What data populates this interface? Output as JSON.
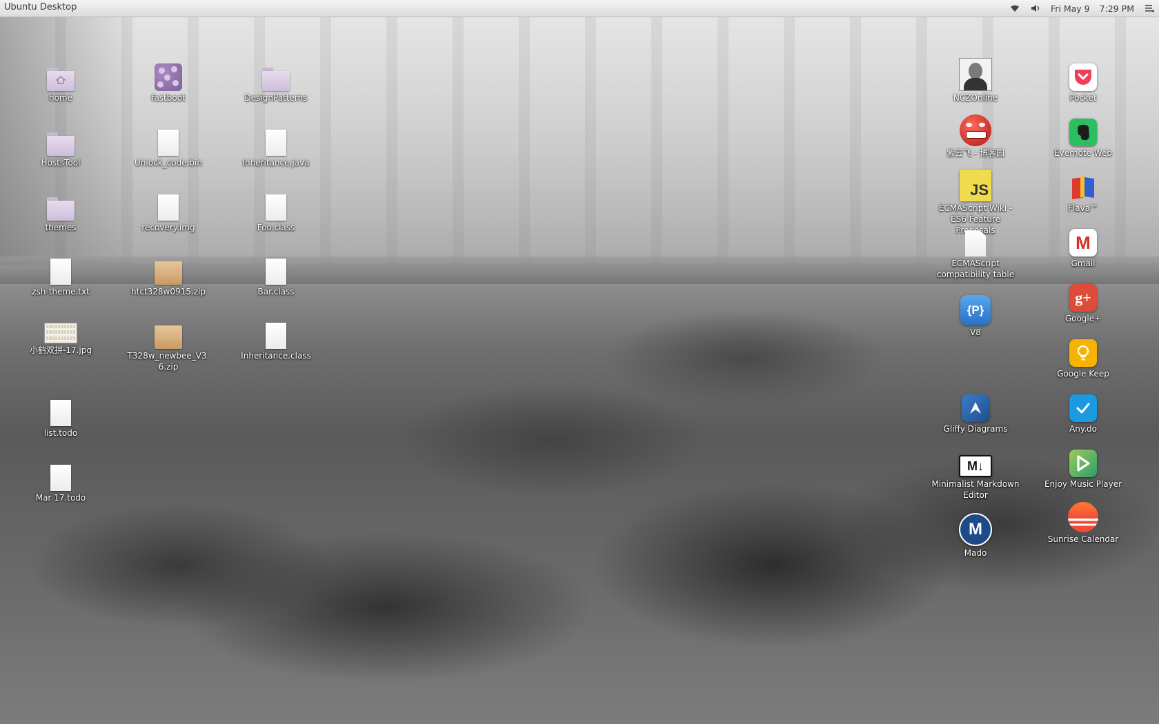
{
  "panel": {
    "title": "Ubuntu Desktop",
    "date": "Fri May  9",
    "time": "7:29 PM",
    "icons": [
      "wifi-icon",
      "volume-icon",
      "menu-icon"
    ]
  },
  "desktop": {
    "col1": [
      {
        "label": "home",
        "type": "folder-home"
      },
      {
        "label": "HostsTool",
        "type": "folder"
      },
      {
        "label": "themes",
        "type": "folder"
      },
      {
        "label": "zsh-theme.txt",
        "type": "file"
      },
      {
        "label": "小鹤双拼-17.jpg",
        "type": "image"
      },
      {
        "label": "list.todo",
        "type": "file"
      },
      {
        "label": "Mar 17.todo",
        "type": "file"
      }
    ],
    "col2": [
      {
        "label": "fastboot",
        "type": "fastboot"
      },
      {
        "label": "Unlock_code.bin",
        "type": "file"
      },
      {
        "label": "recovery.img",
        "type": "file"
      },
      {
        "label": "htct328w0915.zip",
        "type": "zip"
      },
      {
        "label": "T328w_newbee_V3.6.zip",
        "type": "zip"
      }
    ],
    "col3": [
      {
        "label": "DesignPatterns",
        "type": "folder"
      },
      {
        "label": "Inheritance.java",
        "type": "file"
      },
      {
        "label": "Foo.class",
        "type": "file"
      },
      {
        "label": "Bar.class",
        "type": "file"
      },
      {
        "label": "Inheritance.class",
        "type": "file"
      }
    ],
    "col4": [
      {
        "label": "NCZOnline",
        "type": "photo"
      },
      {
        "label": "紫云飞 - 博客园",
        "type": "face"
      },
      {
        "label": "ECMAScript Wiki - ES6 Feature Proposals",
        "type": "js"
      },
      {
        "label": "ECMAScript compatibility table",
        "type": "doc"
      },
      {
        "label": "V8",
        "type": "v8"
      },
      {
        "label": "Gliffy Diagrams",
        "type": "gliffy"
      },
      {
        "label": "Minimalist Markdown Editor",
        "type": "md"
      },
      {
        "label": "Mado",
        "type": "mado"
      }
    ],
    "col5": [
      {
        "label": "Pocket",
        "type": "pocket"
      },
      {
        "label": "Evernote Web",
        "type": "evernote"
      },
      {
        "label": "Flava™",
        "type": "flava"
      },
      {
        "label": "Gmail",
        "type": "gmail"
      },
      {
        "label": "Google+",
        "type": "gplus"
      },
      {
        "label": "Google Keep",
        "type": "keep"
      },
      {
        "label": "Any.do",
        "type": "anydo"
      },
      {
        "label": "Enjoy Music Player",
        "type": "music"
      },
      {
        "label": "Sunrise Calendar",
        "type": "sunrise"
      }
    ]
  },
  "glyph_text": {
    "js": "JS",
    "v8": "{P}",
    "md": "M↓",
    "mado": "M",
    "gplus": "g+",
    "gmail": "M"
  },
  "colors": {
    "pocket": "#ee4056",
    "evernote": "#2dbe60",
    "gmail": "#ffffff",
    "gplus": "#dd4b39",
    "keep": "#f6b400",
    "anydo": "#1a9ae0",
    "music": "#8bc34a",
    "js": "#f0db4f",
    "v8": "#3a7bd5",
    "gliffy": "#2a64a8",
    "mado": "#1e4a8c"
  }
}
